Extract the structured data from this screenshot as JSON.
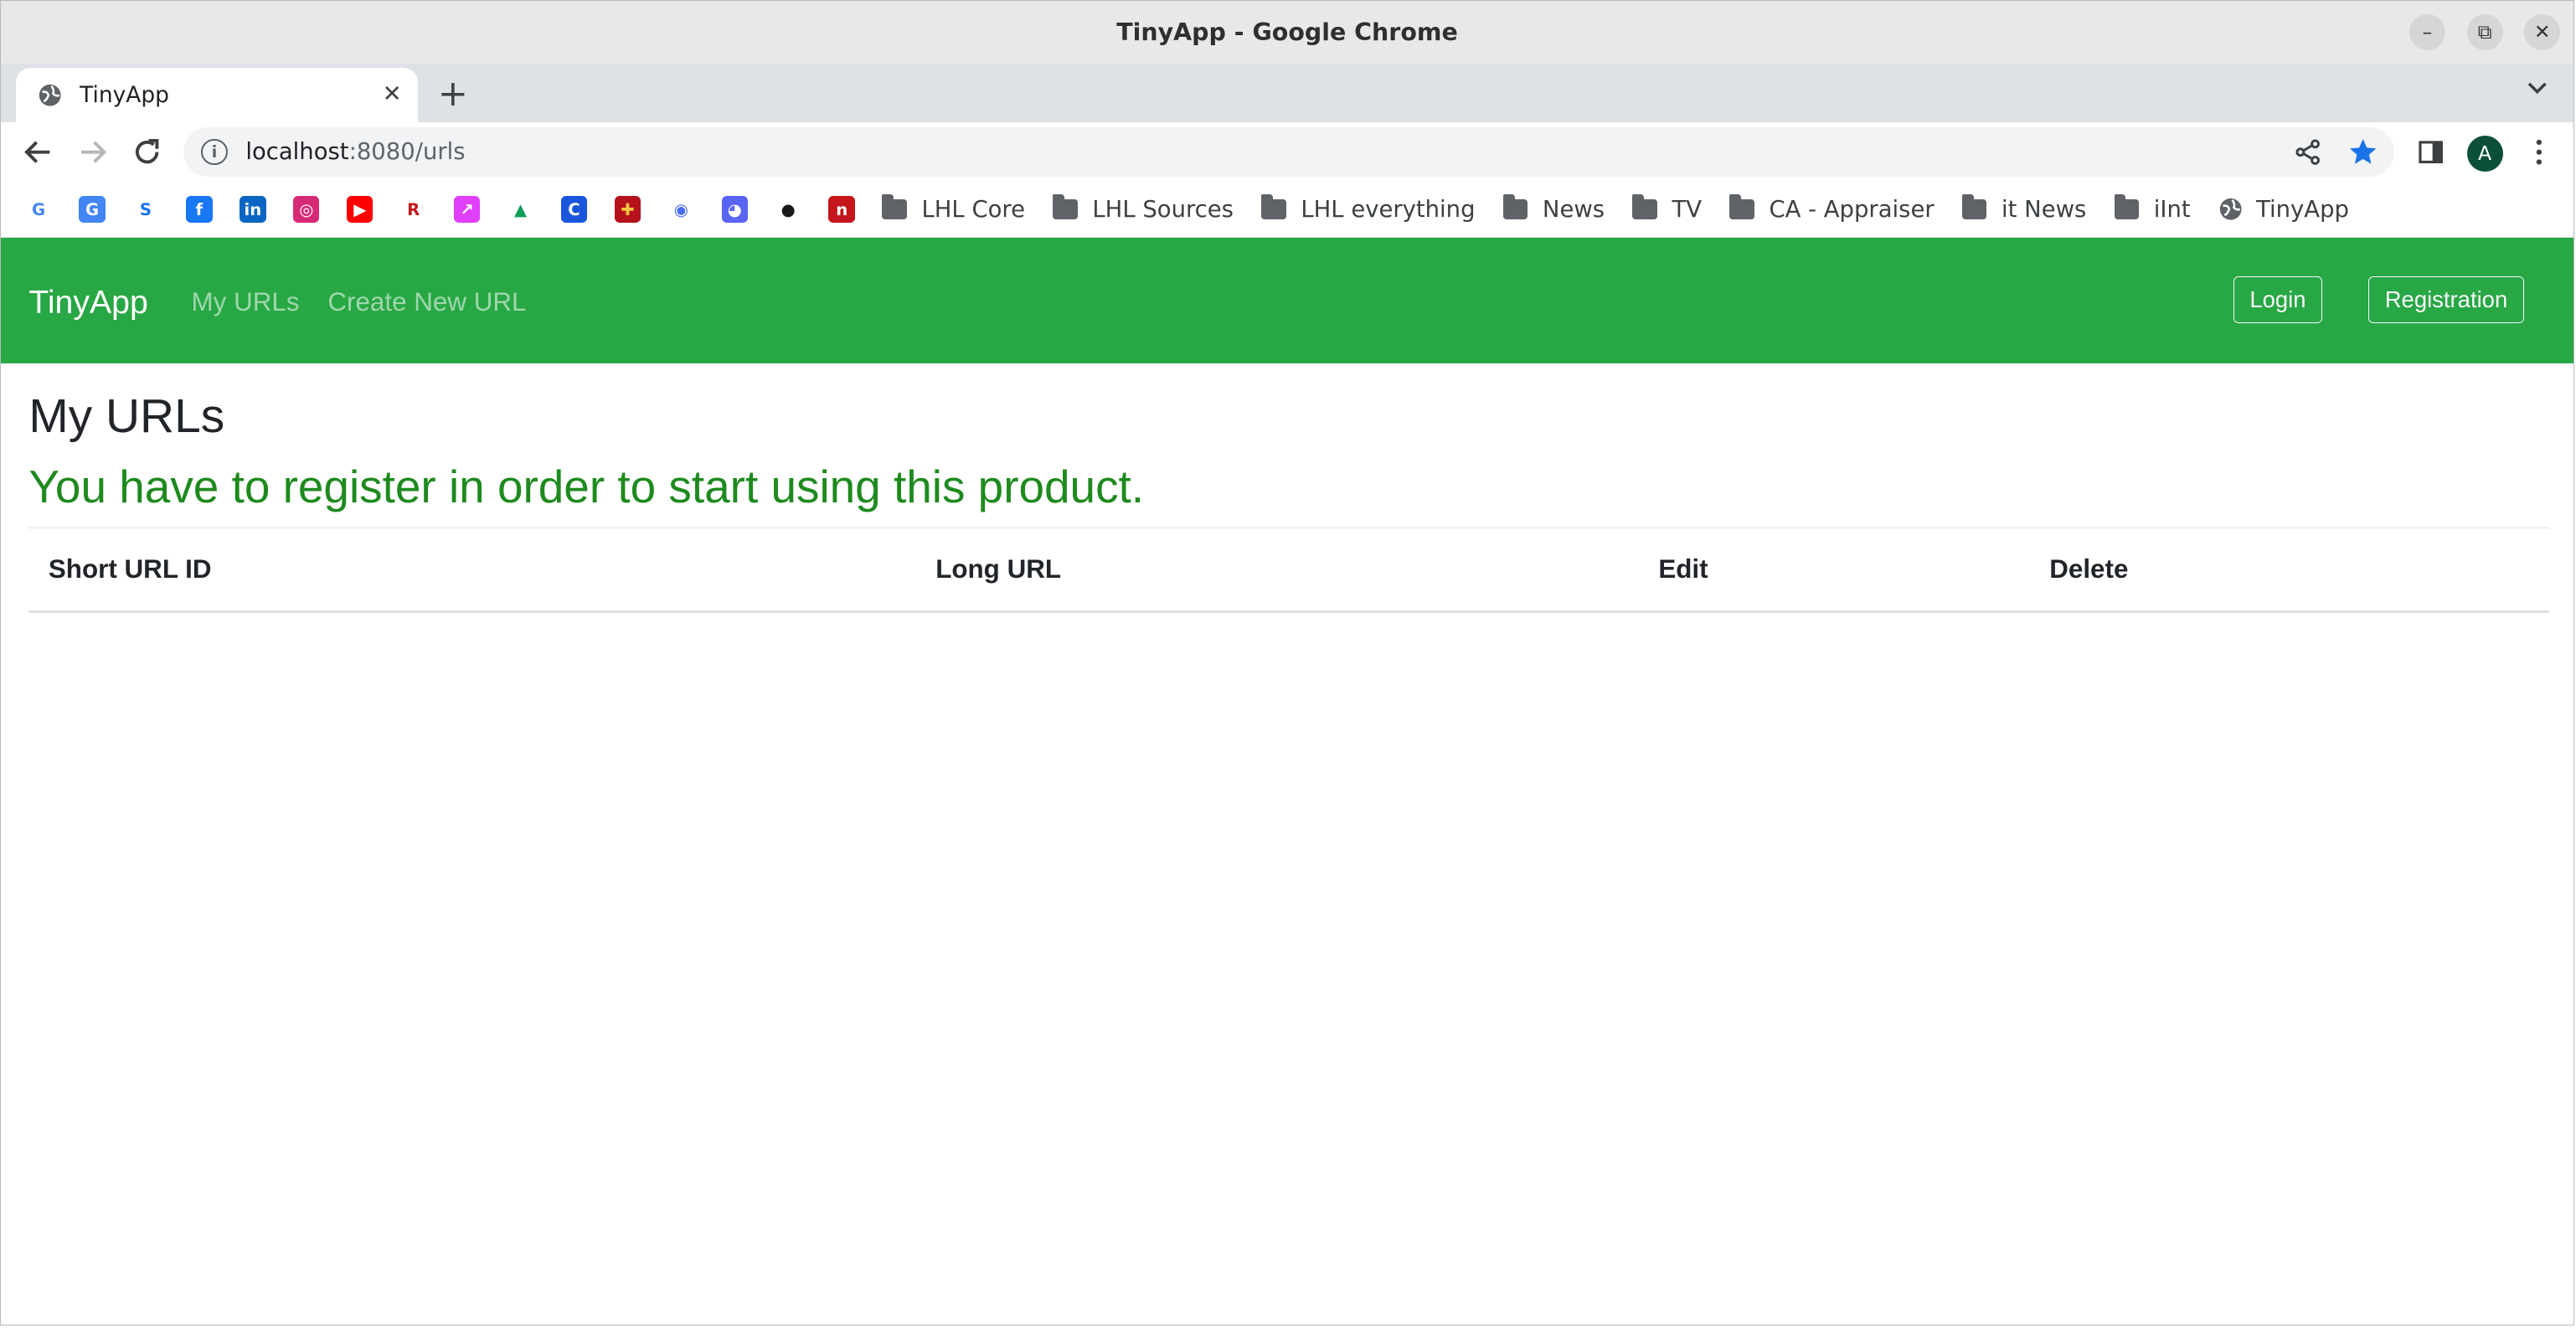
{
  "window": {
    "title": "TinyApp - Google Chrome"
  },
  "tab": {
    "title": "TinyApp"
  },
  "omnibox": {
    "host": "localhost",
    "path": ":8080/urls"
  },
  "profile": {
    "initial": "A"
  },
  "bookmarks": {
    "icons": [
      {
        "name": "google-icon",
        "glyph": "G",
        "color": "#ffffff",
        "fg": "#4285f4"
      },
      {
        "name": "google-translate-icon",
        "glyph": "G",
        "color": "#4285f4",
        "fg": "#ffffff"
      },
      {
        "name": "scribe-icon",
        "glyph": "S",
        "color": "#ffffff",
        "fg": "#1a73e8"
      },
      {
        "name": "facebook-icon",
        "glyph": "f",
        "color": "#1877f2",
        "fg": "#ffffff"
      },
      {
        "name": "linkedin-icon",
        "glyph": "in",
        "color": "#0a66c2",
        "fg": "#ffffff"
      },
      {
        "name": "instagram-icon",
        "glyph": "◎",
        "color": "#d62976",
        "fg": "#ffffff"
      },
      {
        "name": "youtube-icon",
        "glyph": "▶",
        "color": "#ff0000",
        "fg": "#ffffff"
      },
      {
        "name": "bookmark-red-icon",
        "glyph": "R",
        "color": "#ffffff",
        "fg": "#c4161c"
      },
      {
        "name": "gradient-app-icon",
        "glyph": "↗",
        "color": "#e040fb",
        "fg": "#ffffff"
      },
      {
        "name": "google-drive-icon",
        "glyph": "▲",
        "color": "#ffffff",
        "fg": "#0f9d58"
      },
      {
        "name": "c-circle-icon",
        "glyph": "C",
        "color": "#1a56db",
        "fg": "#ffffff"
      },
      {
        "name": "shield-crest-icon",
        "glyph": "✚",
        "color": "#b5121b",
        "fg": "#f4c542"
      },
      {
        "name": "fingerprint-icon",
        "glyph": "◉",
        "color": "#ffffff",
        "fg": "#4a6cf7"
      },
      {
        "name": "discord-icon",
        "glyph": "◕",
        "color": "#5865f2",
        "fg": "#ffffff"
      },
      {
        "name": "github-icon",
        "glyph": "●",
        "color": "#ffffff",
        "fg": "#181717"
      },
      {
        "name": "n-box-icon",
        "glyph": "n",
        "color": "#c4161c",
        "fg": "#ffffff"
      }
    ],
    "folders": [
      "LHL Core",
      "LHL Sources",
      "LHL everything",
      "News",
      "TV",
      "CA - Appraiser",
      "it News",
      "iInt"
    ],
    "last": "TinyApp"
  },
  "navbar": {
    "brand": "TinyApp",
    "links": [
      "My URLs",
      "Create New URL"
    ],
    "login": "Login",
    "register": "Registration",
    "color": "#28a745"
  },
  "main": {
    "title": "My URLs",
    "message": "You have to register in order to start using this product.",
    "message_color": "#1e8a1e",
    "columns": [
      "Short URL ID",
      "Long URL",
      "Edit",
      "Delete"
    ]
  }
}
